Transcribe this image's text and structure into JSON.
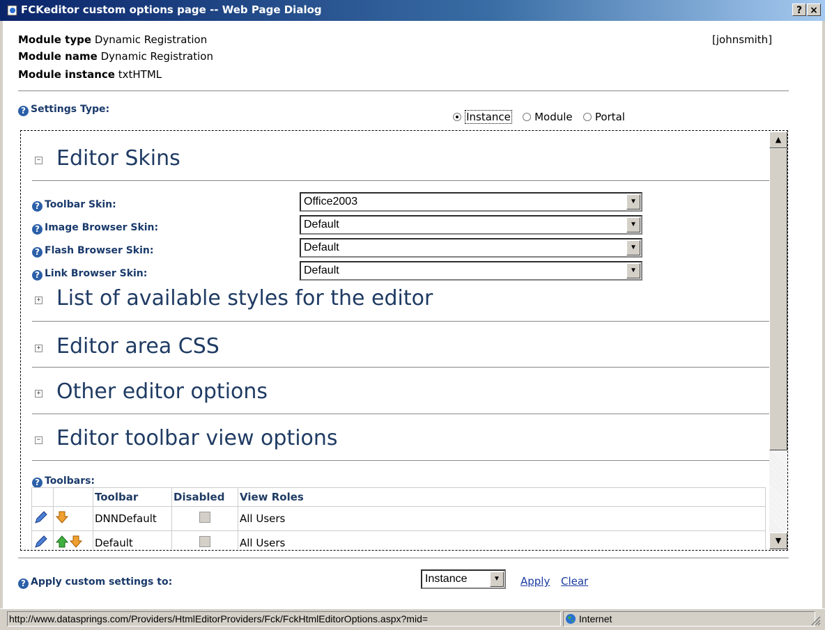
{
  "window": {
    "title": "FCKeditor custom options page -- Web Page Dialog",
    "help_btn": "?",
    "close_btn": "×"
  },
  "header": {
    "module_type_label": "Module type",
    "module_type_value": "Dynamic Registration",
    "module_name_label": "Module name",
    "module_name_value": "Dynamic Registration",
    "module_instance_label": "Module instance",
    "module_instance_value": "txtHTML",
    "user": "[johnsmith]"
  },
  "settings_type": {
    "label": "Settings Type:",
    "options": [
      "Instance",
      "Module",
      "Portal"
    ],
    "selected": "Instance"
  },
  "sections": {
    "editor_skins": "Editor Skins",
    "styles": "List of available styles for the editor",
    "css": "Editor area CSS",
    "other": "Other editor options",
    "toolbar_view": "Editor toolbar view options"
  },
  "skins": [
    {
      "label": "Toolbar Skin:",
      "value": "Office2003"
    },
    {
      "label": "Image Browser Skin:",
      "value": "Default"
    },
    {
      "label": "Flash Browser Skin:",
      "value": "Default"
    },
    {
      "label": "Link Browser Skin:",
      "value": "Default"
    }
  ],
  "toolbars": {
    "label": "Toolbars:",
    "columns": [
      "Toolbar",
      "Disabled",
      "View Roles"
    ],
    "rows": [
      {
        "name": "DNNDefault",
        "roles": "All Users"
      },
      {
        "name": "Default",
        "roles": "All Users"
      }
    ]
  },
  "footer": {
    "label": "Apply custom settings to:",
    "select_value": "Instance",
    "apply": "Apply",
    "clear": "Clear"
  },
  "statusbar": {
    "url": "http://www.dataspring s.com/Providers/HtmlEditorProviders/Fck/FckHtmlEditorOptions.aspx?mid=",
    "zone": "Internet"
  },
  "colors": {
    "heading": "#1f3b63",
    "link": "#1a3aa0",
    "titlebar": "#0a246a"
  }
}
